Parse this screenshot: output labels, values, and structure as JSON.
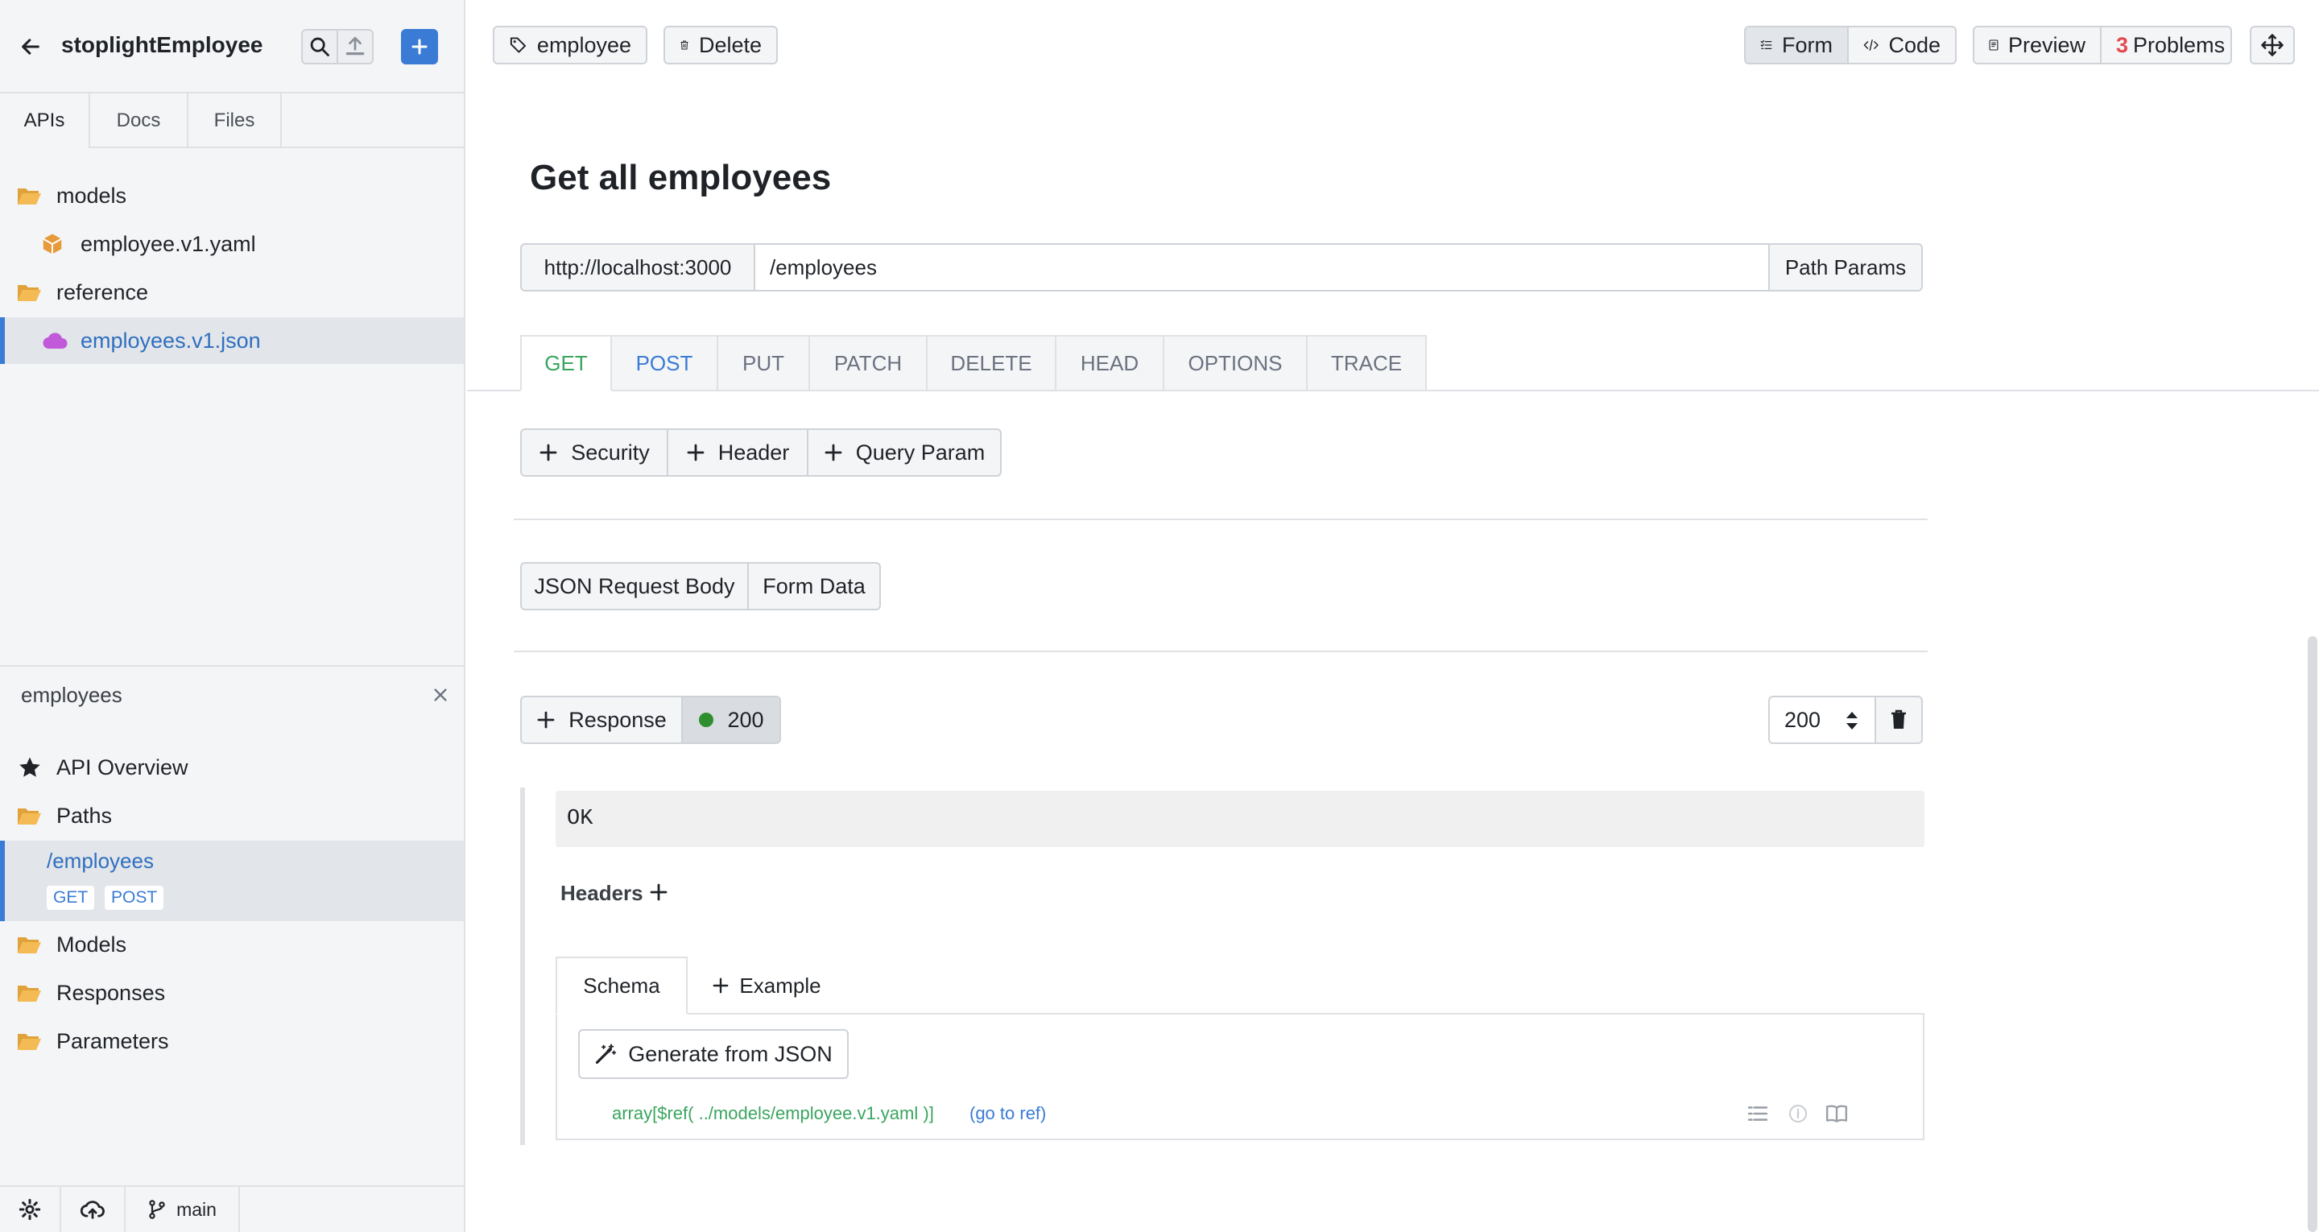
{
  "sidebar": {
    "project_name": "stoplightEmployee",
    "tabs": [
      {
        "label": "APIs"
      },
      {
        "label": "Docs"
      },
      {
        "label": "Files"
      }
    ],
    "file_tree": [
      {
        "label": "models",
        "icon": "folder-open-icon"
      },
      {
        "label": "employee.v1.yaml",
        "icon": "cube-icon"
      },
      {
        "label": "reference",
        "icon": "folder-open-icon"
      },
      {
        "label": "employees.v1.json",
        "icon": "cloud-icon",
        "active": true
      }
    ],
    "outline": {
      "title": "employees",
      "items": [
        {
          "label": "API Overview",
          "icon": "star-icon"
        },
        {
          "label": "Paths",
          "icon": "folder-open-icon"
        },
        {
          "label": "/employees",
          "methods": [
            "GET",
            "POST"
          ],
          "active": true
        },
        {
          "label": "Models",
          "icon": "folder-open-icon"
        },
        {
          "label": "Responses",
          "icon": "folder-open-icon"
        },
        {
          "label": "Parameters",
          "icon": "folder-open-icon"
        }
      ]
    },
    "footer": {
      "branch": "main"
    }
  },
  "toolbar": {
    "tag_label": "employee",
    "delete_label": "Delete",
    "form_label": "Form",
    "code_label": "Code",
    "preview_label": "Preview",
    "problems_count": "3",
    "problems_label": "Problems"
  },
  "operation": {
    "title": "Get all employees",
    "server": "http://localhost:3000",
    "path": "/employees",
    "path_params_label": "Path Params",
    "methods": [
      "GET",
      "POST",
      "PUT",
      "PATCH",
      "DELETE",
      "HEAD",
      "OPTIONS",
      "TRACE"
    ],
    "selected_method": "GET",
    "request_buttons": [
      "Security",
      "Header",
      "Query Param"
    ],
    "body_buttons": [
      "JSON Request Body",
      "Form Data"
    ],
    "response": {
      "add_label": "Response",
      "code_chip": "200",
      "status_code": "200",
      "description": "OK",
      "headers_label": "Headers",
      "schema_tab": "Schema",
      "example_tab": "Example",
      "generate_label": "Generate from JSON",
      "schema_ref": "array[$ref( ../models/employee.v1.yaml )]",
      "goto_ref": "(go to ref)"
    }
  },
  "colors": {
    "accent": "#3a7bd5",
    "get": "#3aa55f",
    "post": "#3a7bd5",
    "success_dot": "#2f8f2f",
    "problems": "#e5484d",
    "folder": "#f0b34a",
    "cube": "#e69a3a",
    "cloud": "#c05ad8"
  }
}
